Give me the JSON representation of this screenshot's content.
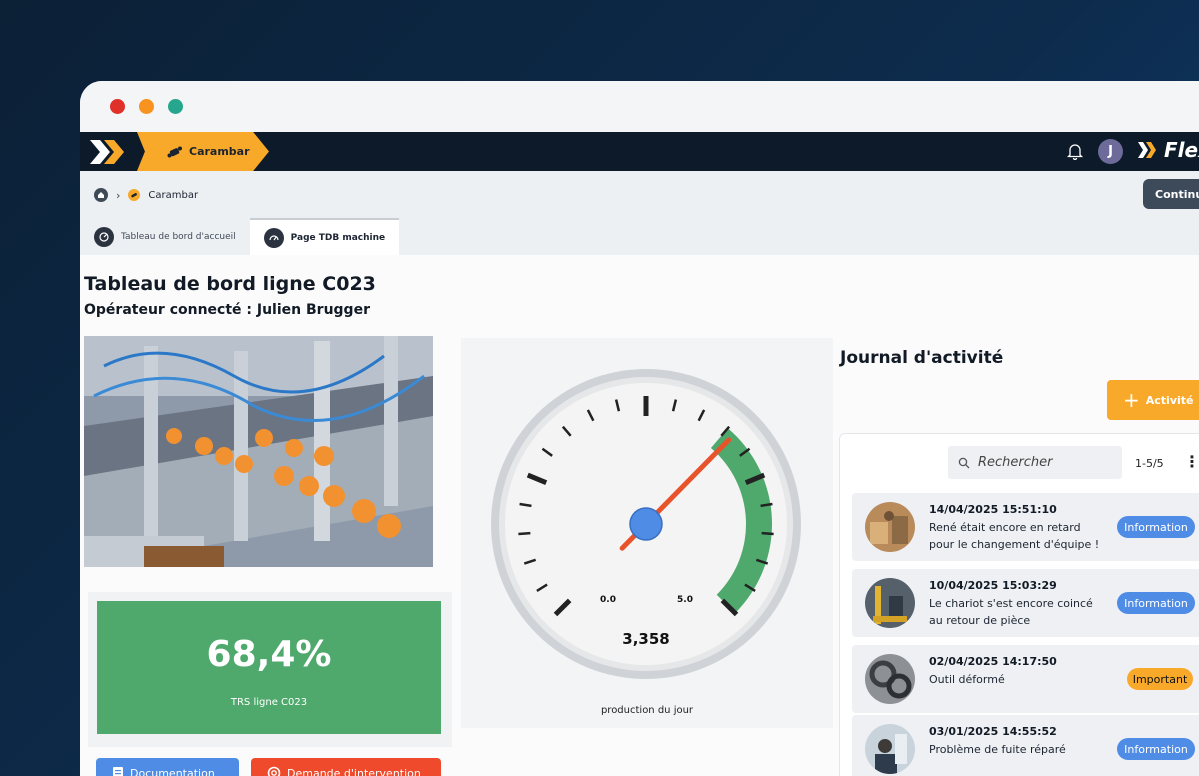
{
  "appbar": {
    "chip_label": "Carambar",
    "avatar_initial": "J",
    "brand": "Flex"
  },
  "breadcrumb": {
    "current": "Carambar"
  },
  "subbar": {
    "continue_label": "Continu"
  },
  "tabs": [
    {
      "label": "Tableau de bord d'accueil",
      "active": false
    },
    {
      "label": "Page TDB machine",
      "active": true
    }
  ],
  "page": {
    "title": "Tableau de bord ligne C023",
    "operator": "Opérateur connecté : Julien Brugger"
  },
  "kpi": {
    "value": "68,4%",
    "label": "TRS ligne C023"
  },
  "actions": {
    "documentation": "Documentation",
    "intervention": "Demande d'intervention"
  },
  "gauge": {
    "min_label": "0.0",
    "max_label": "5.0",
    "value_label": "3,358",
    "caption": "production du jour"
  },
  "journal": {
    "title": "Journal d'activité",
    "add_label": "Activité",
    "search_placeholder": "Rechercher",
    "pager": "1-5/5",
    "entries": [
      {
        "date": "14/04/2025 15:51:10",
        "text": "René était encore en retard pour le changement d'équipe !",
        "badge": "Information"
      },
      {
        "date": "10/04/2025 15:03:29",
        "text": "Le chariot s'est encore coincé au retour de pièce",
        "badge": "Information"
      },
      {
        "date": "02/04/2025 14:17:50",
        "text": "Outil déformé",
        "badge": "Important"
      },
      {
        "date": "03/01/2025 14:55:52",
        "text": "Problème de fuite réparé",
        "badge": "Information"
      }
    ]
  },
  "colors": {
    "accent": "#f8a92a",
    "kpi_green": "#4fa96d",
    "info_blue": "#4f8ce6",
    "alert_red": "#ef4a2b",
    "appbar": "#0c1a2a"
  }
}
